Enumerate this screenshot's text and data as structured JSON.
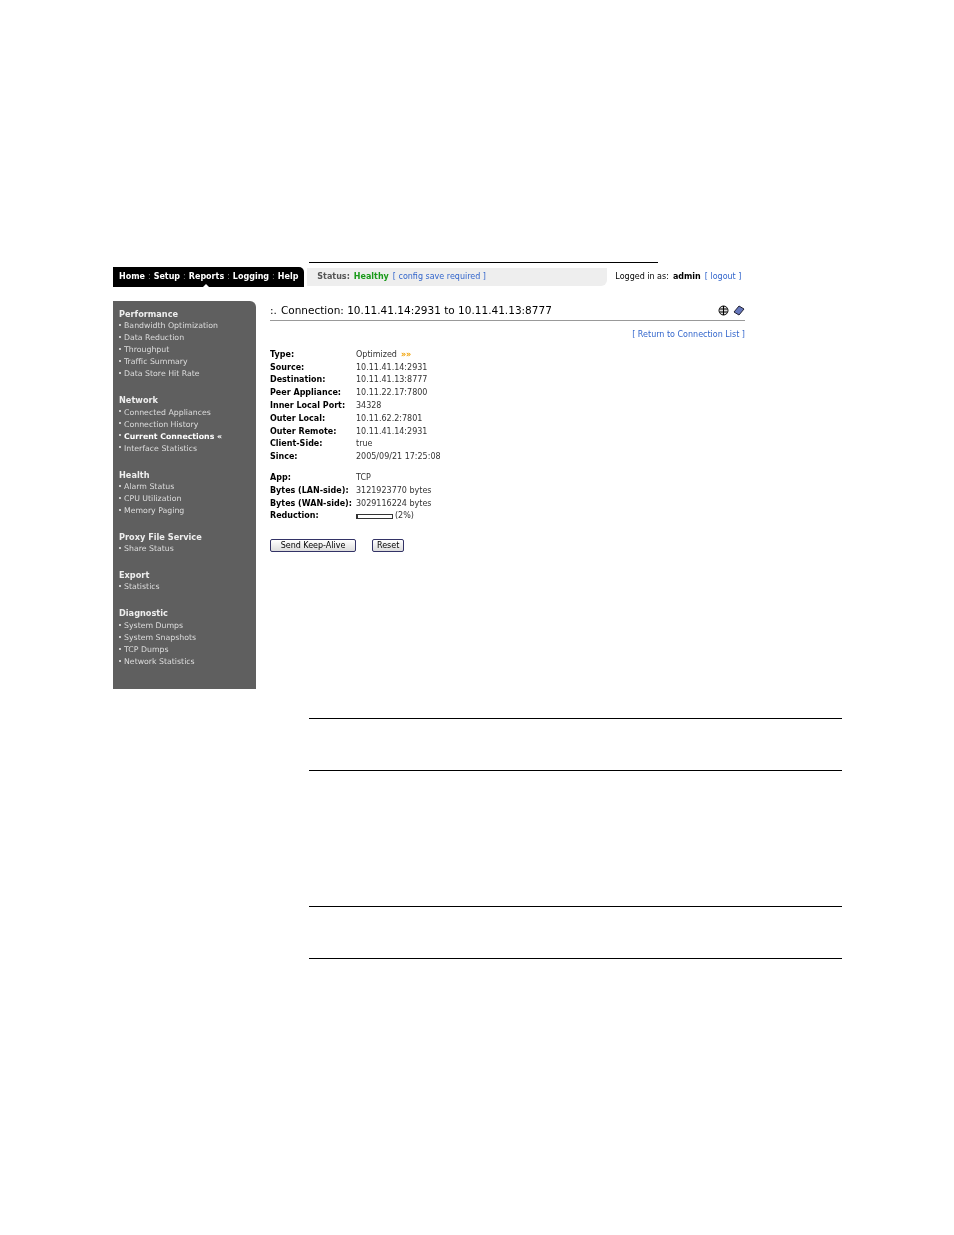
{
  "nav": [
    {
      "label": "Home",
      "selected": false
    },
    {
      "label": "Setup",
      "selected": false,
      "separator": ":"
    },
    {
      "label": "Reports",
      "selected": true,
      "separator": ":"
    },
    {
      "label": "Logging",
      "selected": false,
      "separator": ":"
    },
    {
      "label": "Help",
      "selected": false,
      "separator": ":"
    }
  ],
  "status": {
    "label": "Status:",
    "value": "Healthy",
    "note": "[ config save required ]"
  },
  "login": {
    "label": "Logged in as:",
    "user": "admin",
    "logout": "[ logout ]"
  },
  "sidebar": [
    {
      "title": "Performance",
      "items": [
        {
          "label": "Bandwidth Optimization",
          "selected": false
        },
        {
          "label": "Data Reduction",
          "selected": false
        },
        {
          "label": "Throughput",
          "selected": false
        },
        {
          "label": "Traffic Summary",
          "selected": false
        },
        {
          "label": "Data Store Hit Rate",
          "selected": false
        }
      ]
    },
    {
      "title": "Network",
      "items": [
        {
          "label": "Connected Appliances",
          "selected": false
        },
        {
          "label": "Connection History",
          "selected": false
        },
        {
          "label": "Current Connections",
          "selected": true,
          "marker": "«"
        },
        {
          "label": "Interface Statistics",
          "selected": false
        }
      ]
    },
    {
      "title": "Health",
      "items": [
        {
          "label": "Alarm Status",
          "selected": false
        },
        {
          "label": "CPU Utilization",
          "selected": false
        },
        {
          "label": "Memory Paging",
          "selected": false
        }
      ]
    },
    {
      "title": "Proxy File Service",
      "items": [
        {
          "label": "Share Status",
          "selected": false
        }
      ]
    },
    {
      "title": "Export",
      "items": [
        {
          "label": "Statistics",
          "selected": false
        }
      ]
    },
    {
      "title": "Diagnostic",
      "items": [
        {
          "label": "System Dumps",
          "selected": false
        },
        {
          "label": "System Snapshots",
          "selected": false
        },
        {
          "label": "TCP Dumps",
          "selected": false
        },
        {
          "label": "Network Statistics",
          "selected": false
        }
      ]
    }
  ],
  "page_title": {
    "prefix": ":.",
    "text": "Connection: 10.11.41.14:2931 to 10.11.41.13:8777"
  },
  "return_link": "[ Return to Connection List ]",
  "details": [
    [
      {
        "label": "Type:",
        "value": "Optimized",
        "kind": "optimized",
        "arrows": "»»"
      },
      {
        "label": "Source:",
        "value": "10.11.41.14:2931",
        "kind": "text"
      },
      {
        "label": "Destination:",
        "value": "10.11.41.13:8777",
        "kind": "text"
      },
      {
        "label": "Peer Appliance:",
        "value": "10.11.22.17:7800",
        "kind": "text"
      },
      {
        "label": "Inner Local Port:",
        "value": "34328",
        "kind": "text"
      },
      {
        "label": "Outer Local:",
        "value": "10.11.62.2:7801",
        "kind": "text"
      },
      {
        "label": "Outer Remote:",
        "value": "10.11.41.14:2931",
        "kind": "text"
      },
      {
        "label": "Client-Side:",
        "value": "true",
        "kind": "text"
      },
      {
        "label": "Since:",
        "value": "2005/09/21 17:25:08",
        "kind": "text"
      }
    ],
    [
      {
        "label": "App:",
        "value": "TCP",
        "kind": "text"
      },
      {
        "label": "Bytes (LAN-side):",
        "value": "3121923770 bytes",
        "kind": "text"
      },
      {
        "label": "Bytes (WAN-side):",
        "value": "3029116224 bytes",
        "kind": "text"
      },
      {
        "label": "Reduction:",
        "value": "(2%)",
        "kind": "meter",
        "level": 0.02
      }
    ]
  ],
  "buttons": [
    "Send Keep-Alive",
    "Reset"
  ]
}
